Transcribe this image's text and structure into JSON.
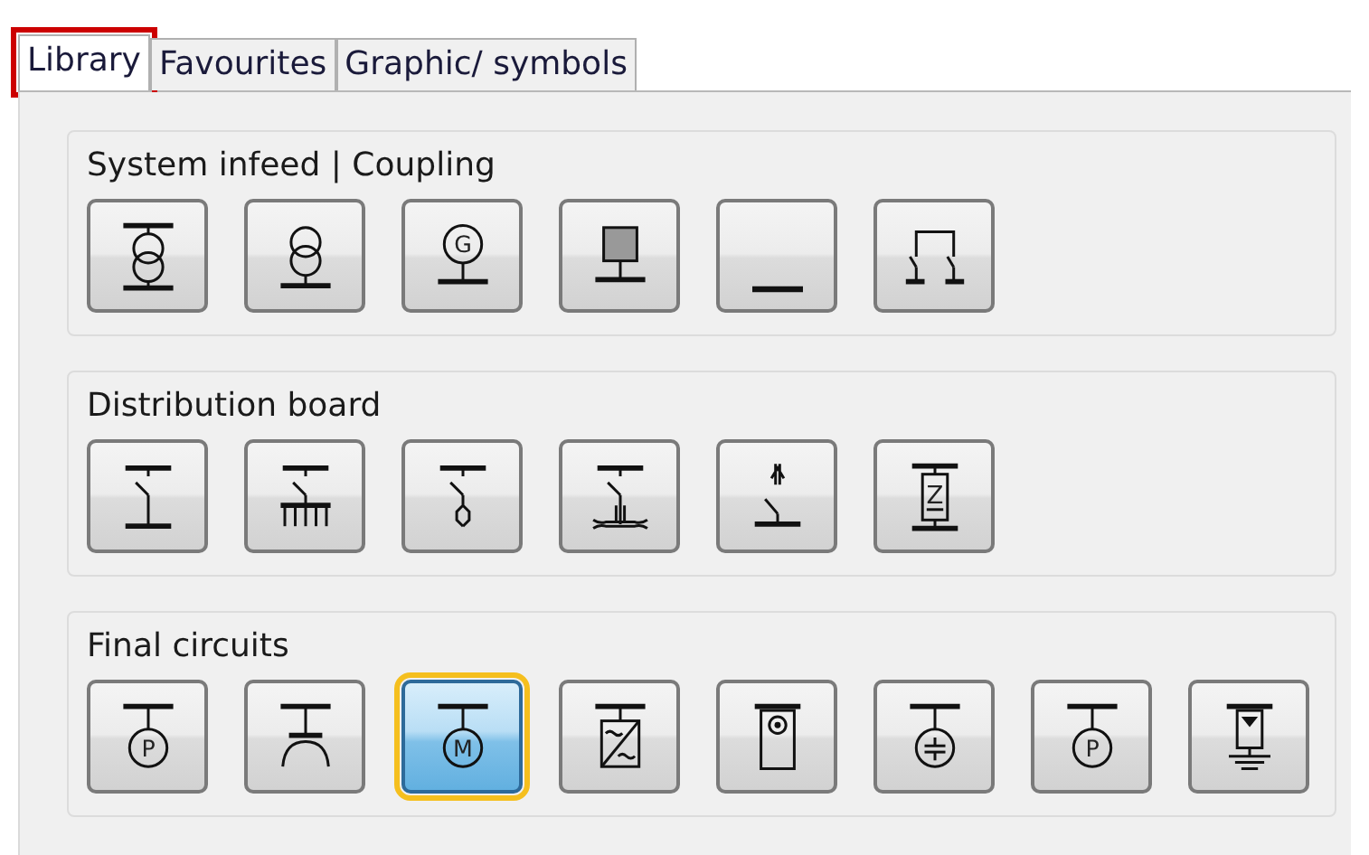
{
  "tabs": [
    {
      "label": "Library",
      "selected": true,
      "highlighted": true
    },
    {
      "label": "Favourites",
      "selected": false,
      "highlighted": false
    },
    {
      "label": "Graphic/ symbols",
      "selected": false,
      "highlighted": false
    }
  ],
  "groups": [
    {
      "title": "System infeed | Coupling",
      "buttons": [
        {
          "kind": "transformer3",
          "selected": false
        },
        {
          "kind": "transformer2",
          "selected": false
        },
        {
          "kind": "generator",
          "letter": "G",
          "selected": false
        },
        {
          "kind": "network",
          "selected": false
        },
        {
          "kind": "busbar",
          "selected": false
        },
        {
          "kind": "coupling",
          "selected": false
        }
      ]
    },
    {
      "title": "Distribution board",
      "buttons": [
        {
          "kind": "switch",
          "selected": false
        },
        {
          "kind": "switchcomb",
          "selected": false
        },
        {
          "kind": "switchfuse",
          "selected": false
        },
        {
          "kind": "switchcable",
          "selected": false
        },
        {
          "kind": "switchplug",
          "selected": false
        },
        {
          "kind": "impedance",
          "letter": "Z",
          "selected": false
        }
      ]
    },
    {
      "title": "Final circuits",
      "buttons": [
        {
          "kind": "circleload",
          "letter": "P",
          "selected": false
        },
        {
          "kind": "socket",
          "selected": false
        },
        {
          "kind": "circleload",
          "letter": "M",
          "selected": true
        },
        {
          "kind": "converter",
          "selected": false
        },
        {
          "kind": "device",
          "selected": false
        },
        {
          "kind": "capacitor",
          "selected": false
        },
        {
          "kind": "circleload",
          "letter": "P",
          "selected": false
        },
        {
          "kind": "ground",
          "selected": false
        }
      ]
    }
  ]
}
